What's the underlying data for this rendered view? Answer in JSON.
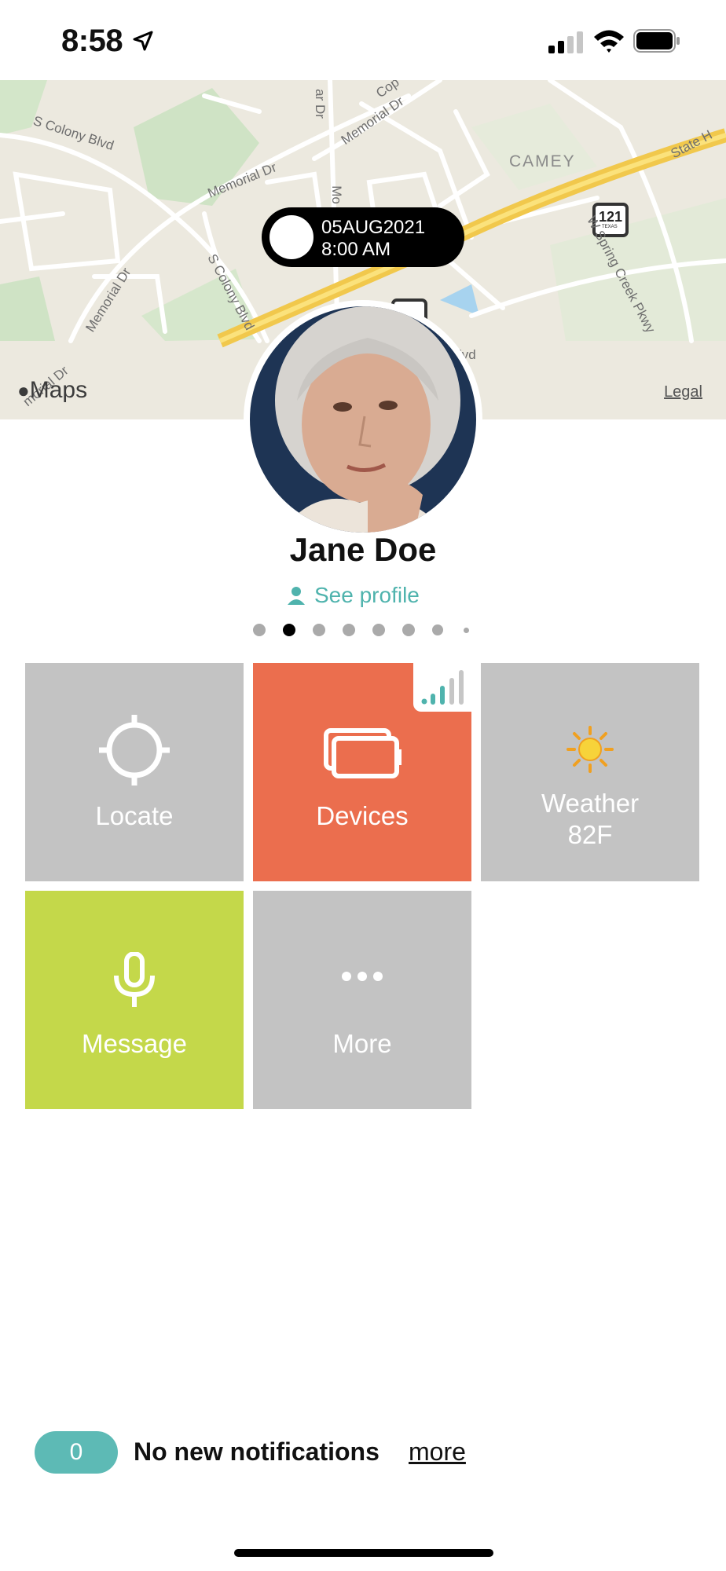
{
  "status_bar": {
    "time": "8:58",
    "icons": [
      "location-arrow-icon",
      "cellular-signal-icon",
      "wifi-icon",
      "battery-icon"
    ]
  },
  "map": {
    "labels": {
      "s_colony_blvd": "S Colony Blvd",
      "memorial_dr_1": "Memorial Dr",
      "memorial_dr_2": "Memorial Dr",
      "memorial_dr_3": "Memorial Dr",
      "s_colony_blvd_2": "S Colony Blvd",
      "camey": "CAMEY",
      "w_spring_creek": "W Spring Creek Pkwy",
      "state_hwy": "State H",
      "shield_121": "121",
      "shield_121_sub": "TEXAS",
      "cop": "Cop",
      "ar_dr": "ar Dr",
      "mo": "Mo",
      "lvd": "lvd",
      "morial": "morial Dr"
    },
    "maps_logo": "Maps",
    "legal": "Legal",
    "date_line1": "05AUG2021",
    "date_line2": "8:00 AM"
  },
  "profile": {
    "name": "Jane Doe",
    "see_profile": "See profile"
  },
  "pager": {
    "count": 8,
    "active_index": 1
  },
  "tiles": {
    "locate": {
      "label": "Locate",
      "color": "#c3c3c3"
    },
    "devices": {
      "label": "Devices",
      "color": "#eb6e4e"
    },
    "weather": {
      "line1": "Weather",
      "line2": "82F",
      "color": "#c3c3c3"
    },
    "message": {
      "label": "Message",
      "color": "#c4d84a"
    },
    "more": {
      "label": "More",
      "color": "#c3c3c3"
    }
  },
  "notifications": {
    "count": "0",
    "text": "No new notifications",
    "more": "more",
    "accent": "#5dbab5"
  }
}
